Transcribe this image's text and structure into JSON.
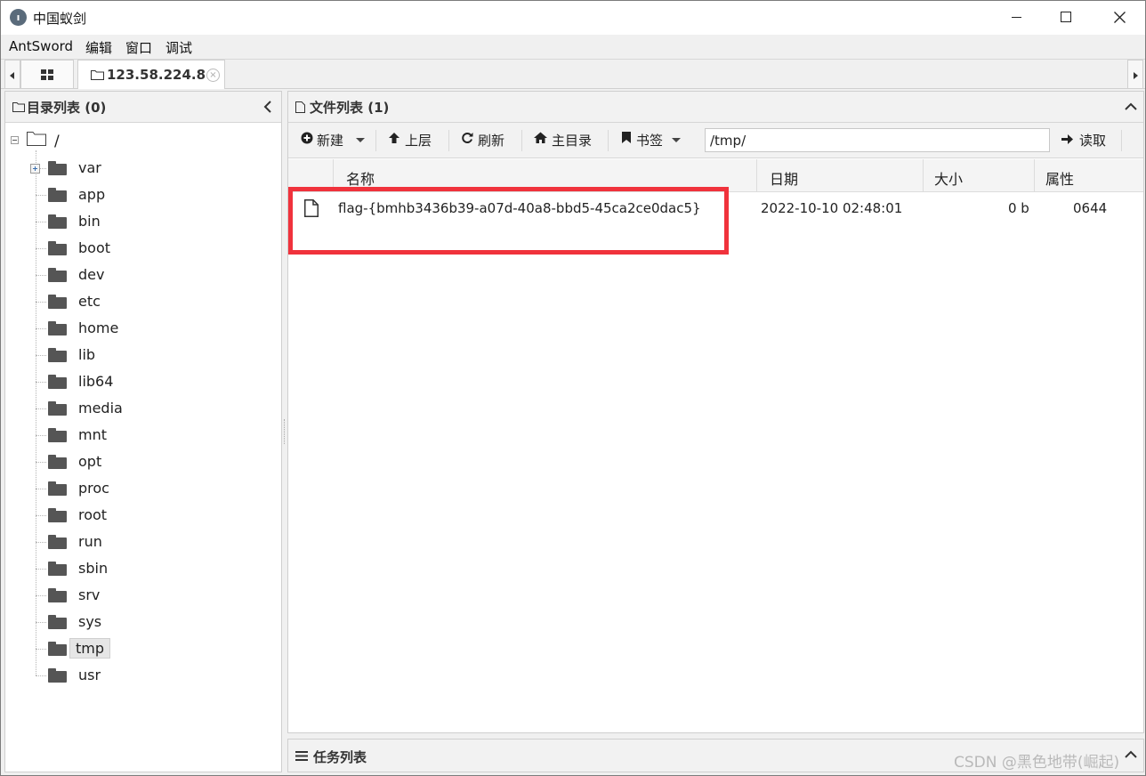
{
  "window": {
    "title": "中国蚁剑"
  },
  "menu": {
    "items": [
      "AntSword",
      "编辑",
      "窗口",
      "调试"
    ]
  },
  "tabs": {
    "connection_label": "123.58.224.8"
  },
  "left_panel": {
    "title": "目录列表 (0)",
    "root_label": "/",
    "folders": [
      "var",
      "app",
      "bin",
      "boot",
      "dev",
      "etc",
      "home",
      "lib",
      "lib64",
      "media",
      "mnt",
      "opt",
      "proc",
      "root",
      "run",
      "sbin",
      "srv",
      "sys",
      "tmp",
      "usr"
    ],
    "selected_folder": "tmp"
  },
  "right_panel": {
    "title": "文件列表 (1)",
    "toolbar": {
      "new_label": "新建",
      "up_label": "上层",
      "refresh_label": "刷新",
      "home_label": "主目录",
      "bookmark_label": "书签",
      "path_value": "/tmp/",
      "read_label": "读取"
    },
    "columns": {
      "name": "名称",
      "date": "日期",
      "size": "大小",
      "attr": "属性"
    },
    "files": [
      {
        "name": "flag-{bmhb3436b39-a07d-40a8-bbd5-45ca2ce0dac5}",
        "date": "2022-10-10 02:48:01",
        "size": "0 b",
        "attr": "0644"
      }
    ]
  },
  "task_panel": {
    "title": "任务列表",
    "watermark": "CSDN @黑色地带(崛起)"
  },
  "colors": {
    "highlight_border": "#f0323c",
    "folder": "#555555"
  }
}
